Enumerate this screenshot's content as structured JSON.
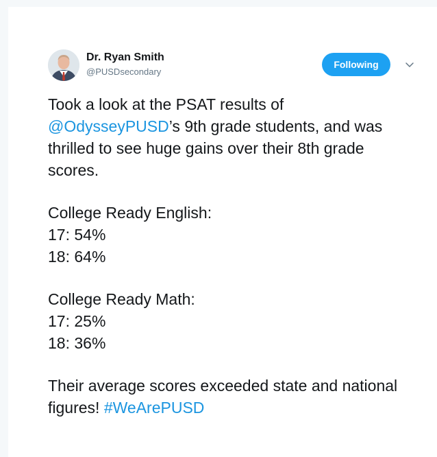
{
  "tweet": {
    "author_name": "Dr. Ryan Smith",
    "author_handle": "@PUSDsecondary",
    "follow_label": "Following",
    "intro": {
      "part1": "Took a look at the PSAT results of ",
      "mention": "@OdysseyPUSD",
      "part2": "’s 9th grade students, and was thrilled to see huge gains over their 8th grade scores."
    },
    "english": {
      "heading": "College Ready English:",
      "line1": "17: 54%",
      "line2": "18: 64%"
    },
    "math": {
      "heading": "College Ready Math:",
      "line1": "17: 25%",
      "line2": "18: 36%"
    },
    "closing": {
      "text": "Their average scores exceeded state and national figures! ",
      "hashtag": "#WeArePUSD"
    }
  },
  "colors": {
    "accent": "#1da1f2",
    "link": "#1b95e0",
    "text": "#14171a",
    "muted": "#657786"
  }
}
